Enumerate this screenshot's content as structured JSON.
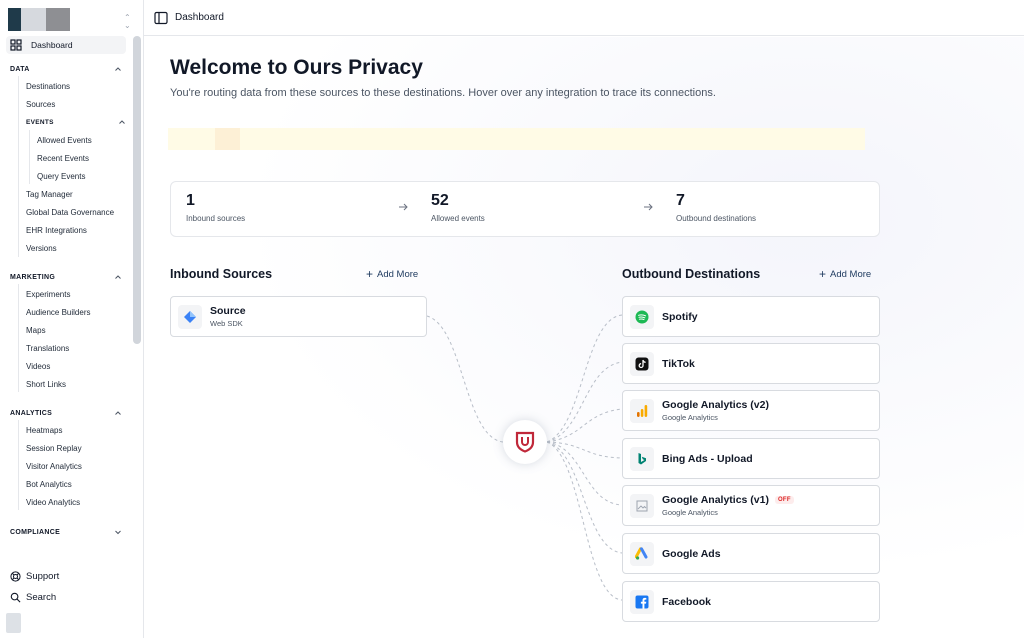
{
  "sidebar": {
    "workspace_colors": [
      "#1f3a4a",
      "#d6d9de",
      "#8e8f93"
    ],
    "dashboard_label": "Dashboard",
    "sections": {
      "data": {
        "label": "DATA",
        "items": [
          "Destinations",
          "Sources"
        ],
        "events": {
          "label": "EVENTS",
          "items": [
            "Allowed Events",
            "Recent Events",
            "Query Events"
          ]
        },
        "items_after": [
          "Tag Manager",
          "Global Data Governance",
          "EHR Integrations",
          "Versions"
        ]
      },
      "marketing": {
        "label": "MARKETING",
        "items": [
          "Experiments",
          "Audience Builders",
          "Maps",
          "Translations",
          "Videos",
          "Short Links"
        ]
      },
      "analytics": {
        "label": "ANALYTICS",
        "items": [
          "Heatmaps",
          "Session Replay",
          "Visitor Analytics",
          "Bot Analytics",
          "Video Analytics"
        ]
      },
      "compliance": {
        "label": "COMPLIANCE"
      }
    },
    "support_label": "Support",
    "search_label": "Search"
  },
  "header": {
    "breadcrumb": "Dashboard"
  },
  "main": {
    "title": "Welcome to Ours Privacy",
    "subtitle": "You're routing data from these sources to these destinations. Hover over any integration to trace its connections.",
    "stats": [
      {
        "value": "1",
        "label": "Inbound sources"
      },
      {
        "value": "52",
        "label": "Allowed events"
      },
      {
        "value": "7",
        "label": "Outbound destinations"
      }
    ],
    "inbound": {
      "title": "Inbound Sources",
      "add_more": "Add More",
      "sources": [
        {
          "name": "Source",
          "sub": "Web SDK",
          "icon": "diamond-icon"
        }
      ]
    },
    "outbound": {
      "title": "Outbound Destinations",
      "add_more": "Add More",
      "destinations": [
        {
          "name": "Spotify",
          "sub": "",
          "icon": "spotify-icon"
        },
        {
          "name": "TikTok",
          "sub": "",
          "icon": "tiktok-icon"
        },
        {
          "name": "Google Analytics (v2)",
          "sub": "Google Analytics",
          "icon": "google-analytics-icon"
        },
        {
          "name": "Bing Ads - Upload",
          "sub": "",
          "icon": "bing-icon"
        },
        {
          "name": "Google Analytics (v1)",
          "sub": "Google Analytics",
          "icon": "broken-image-icon",
          "badge": "OFF"
        },
        {
          "name": "Google Ads",
          "sub": "",
          "icon": "google-ads-icon"
        },
        {
          "name": "Facebook",
          "sub": "",
          "icon": "facebook-icon"
        }
      ]
    },
    "hub_icon": "ours-privacy-logo-icon",
    "colors": {
      "accent": "#1e3a5f",
      "off_badge": "#dc2626",
      "hub_logo": "#c0283a",
      "banner": "#fffbe6"
    }
  }
}
